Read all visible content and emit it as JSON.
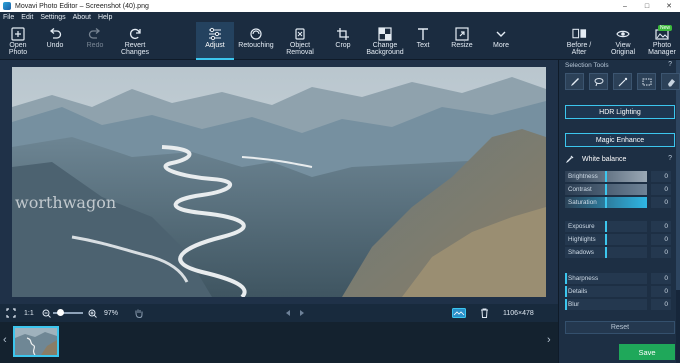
{
  "window": {
    "title": "Movavi Photo Editor – Screenshot (40).png",
    "controls": [
      "–",
      "□",
      "✕"
    ]
  },
  "menu": [
    "File",
    "Edit",
    "Settings",
    "About",
    "Help"
  ],
  "toolbar": {
    "open": "Open\nPhoto",
    "undo": "Undo",
    "redo": "Redo",
    "revert": "Revert\nChanges",
    "adjust": "Adjust",
    "retouching": "Retouching",
    "object_removal": "Object\nRemoval",
    "crop": "Crop",
    "change_bg": "Change\nBackground",
    "text": "Text",
    "resize": "Resize",
    "more": "More",
    "before_after": "Before /\nAfter",
    "view_original": "View\nOriginal",
    "photo_manager": "Photo\nManager",
    "new_badge": "New"
  },
  "canvas": {
    "watermark": "worthwagon"
  },
  "bottom": {
    "fit": "1:1",
    "zoom": "97%",
    "dimensions": "1106×478"
  },
  "panel": {
    "selection_title": "Selection Tools",
    "help": "?",
    "hdr": "HDR Lighting",
    "magic": "Magic Enhance",
    "white_balance": "White balance",
    "sliders_a": [
      {
        "label": "Brightness",
        "value": "0",
        "level": 0.5
      },
      {
        "label": "Contrast",
        "value": "0",
        "level": 0.5
      },
      {
        "label": "Saturation",
        "value": "0",
        "level": 0.5
      }
    ],
    "sliders_b": [
      {
        "label": "Exposure",
        "value": "0",
        "level": 0.5
      },
      {
        "label": "Highlights",
        "value": "0",
        "level": 0.5
      },
      {
        "label": "Shadows",
        "value": "0",
        "level": 0.5
      }
    ],
    "sliders_c": [
      {
        "label": "Sharpness",
        "value": "0",
        "level": 0.0
      },
      {
        "label": "Details",
        "value": "0",
        "level": 0.0
      },
      {
        "label": "Blur",
        "value": "0",
        "level": 0.0
      }
    ],
    "reset": "Reset"
  },
  "save": "Save",
  "colors": {
    "accent": "#3cc6ee",
    "save": "#1fa85a",
    "background": "#1b2c40"
  }
}
